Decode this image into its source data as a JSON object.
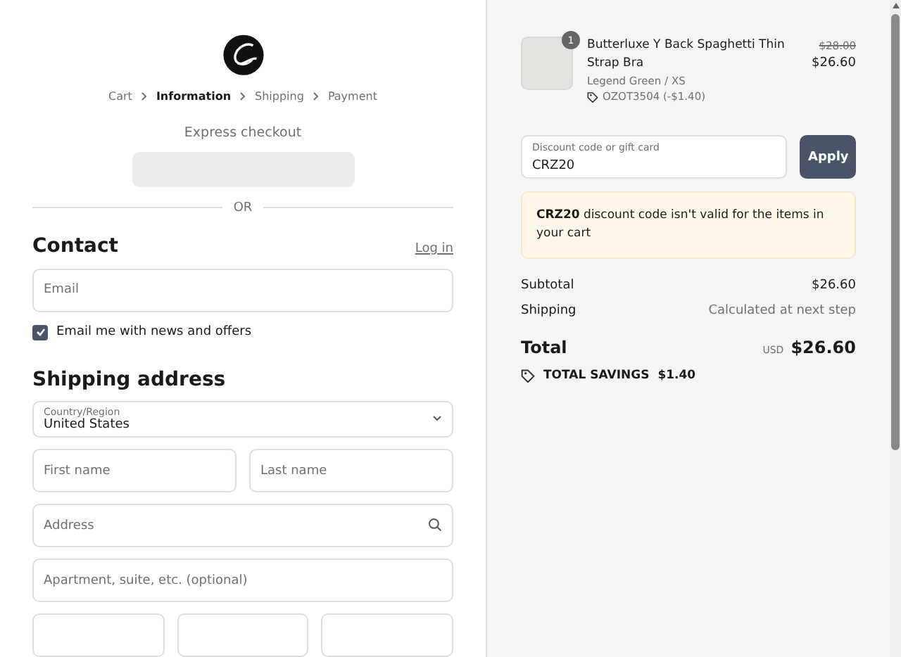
{
  "breadcrumbs": [
    {
      "label": "Cart",
      "selected": false
    },
    {
      "label": "Information",
      "selected": true
    },
    {
      "label": "Shipping",
      "selected": false
    },
    {
      "label": "Payment",
      "selected": false
    }
  ],
  "express_checkout": {
    "title": "Express checkout",
    "divider": "OR"
  },
  "contact": {
    "title": "Contact",
    "login_link": "Log in",
    "email": {
      "placeholder": "Email"
    },
    "newsletter": {
      "label": "Email me with news and offers",
      "checked": true
    }
  },
  "shipping_address": {
    "title": "Shipping address",
    "country": {
      "label": "Country/Region",
      "value": "United States"
    },
    "fields": [
      [
        {
          "placeholder": "First name"
        },
        {
          "placeholder": "Last name"
        }
      ],
      [
        {
          "placeholder": "Address",
          "kind": "search"
        }
      ],
      [
        {
          "placeholder": "Apartment, suite, etc. (optional)"
        }
      ],
      [
        {
          "kind": "plain"
        },
        {
          "kind": "plain"
        },
        {
          "kind": "plain"
        }
      ]
    ]
  },
  "order_summary": {
    "item": {
      "quantity": "1",
      "name": "Butterluxe Y Back Spaghetti Thin Strap Bra",
      "variant": "Legend Green / XS",
      "discount": "OZOT3504 (-$1.40)",
      "original_price": "$28.00",
      "price": "$26.60"
    },
    "discount_field": {
      "label": "Discount code or gift card",
      "value": "CRZ20"
    },
    "apply_button": "Apply",
    "error": "**CRZ20** discount code isn't valid for the items in your cart",
    "subtotal": {
      "label": "Subtotal",
      "value": "$26.60"
    },
    "shipping": {
      "label": "Shipping",
      "value": "Calculated at next step"
    },
    "total": {
      "label": "Total",
      "currency": "USD",
      "value": "$26.60"
    },
    "savings": {
      "label": "TOTAL SAVINGS",
      "value": "$1.40"
    }
  }
}
